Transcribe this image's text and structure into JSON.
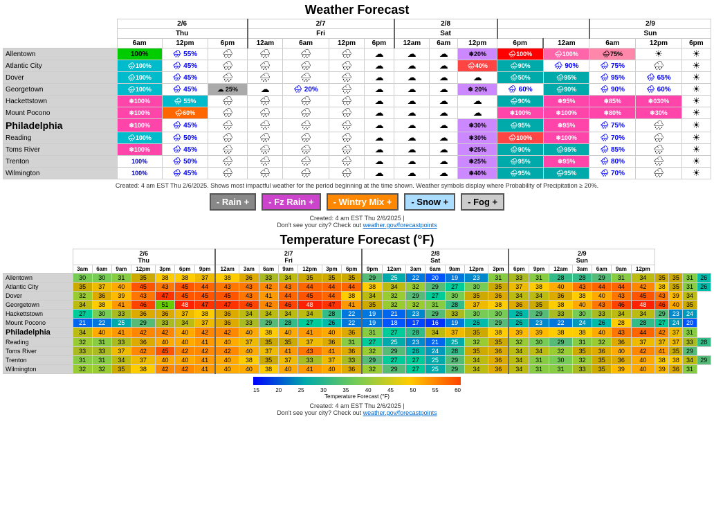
{
  "title": "Weather Forecast",
  "tempTitle": "Temperature Forecast (°F)",
  "note1": "Created: 4 am EST Thu 2/6/2025. Shows most impactful weather for the period beginning at the time shown. Weather symbols display where Probability of Precipitation ≥ 20%.",
  "note2": "Created: 4 am EST Thu 2/6/2025 |",
  "note3": "Don't see your city? Check out",
  "link": "weather.gov/forecastpoints",
  "legend": {
    "rain": "- Rain +",
    "fzrain": "- Fz Rain +",
    "wintry": "- Wintry Mix +",
    "snow": "- Snow +",
    "fog": "- Fog +"
  },
  "dates": [
    "2/6",
    "2/7",
    "2/8",
    "2/9"
  ],
  "days": [
    "Thu",
    "Fri",
    "Sat",
    "Sun"
  ],
  "cities": [
    "Allentown",
    "Atlantic City",
    "Dover",
    "Georgetown",
    "Hackettstown",
    "Mount Pocono",
    "Philadelphia",
    "Reading",
    "Toms River",
    "Trenton",
    "Wilmington"
  ]
}
